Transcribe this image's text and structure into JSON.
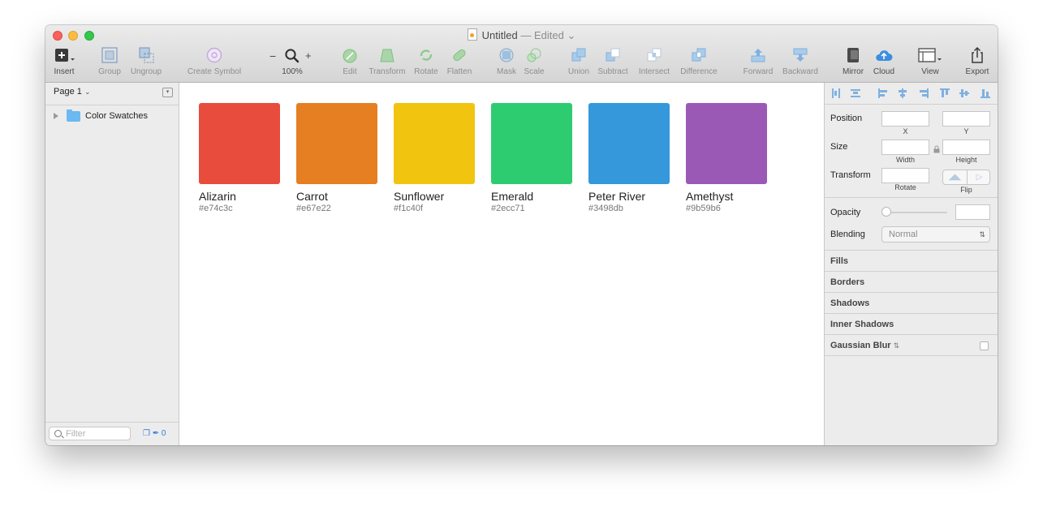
{
  "window": {
    "title": "Untitled",
    "status": "— Edited",
    "status_chevron": "⌄"
  },
  "toolbar": {
    "insert": {
      "label": "Insert",
      "icon": "plus-box-icon"
    },
    "group": {
      "label": "Group",
      "icon": "group-icon"
    },
    "ungroup": {
      "label": "Ungroup",
      "icon": "ungroup-icon"
    },
    "create_symbol": {
      "label": "Create Symbol",
      "icon": "symbol-icon"
    },
    "zoom": {
      "minus": "−",
      "plus": "+",
      "value": "100%",
      "icon": "magnifier-icon"
    },
    "edit": {
      "label": "Edit"
    },
    "transform": {
      "label": "Transform"
    },
    "rotate": {
      "label": "Rotate"
    },
    "flatten": {
      "label": "Flatten"
    },
    "mask": {
      "label": "Mask"
    },
    "scale": {
      "label": "Scale"
    },
    "union": {
      "label": "Union"
    },
    "subtract": {
      "label": "Subtract"
    },
    "intersect": {
      "label": "Intersect"
    },
    "difference": {
      "label": "Difference"
    },
    "forward": {
      "label": "Forward"
    },
    "backward": {
      "label": "Backward"
    },
    "mirror": {
      "label": "Mirror"
    },
    "cloud": {
      "label": "Cloud"
    },
    "view": {
      "label": "View"
    },
    "export": {
      "label": "Export"
    }
  },
  "sidebar": {
    "page_selector": "Page 1",
    "layers": [
      {
        "name": "Color Swatches",
        "icon": "folder-icon"
      }
    ],
    "filter_placeholder": "Filter",
    "count": "0"
  },
  "canvas": {
    "swatches": [
      {
        "name": "Alizarin",
        "hex": "#e74c3c",
        "color": "#e74c3c"
      },
      {
        "name": "Carrot",
        "hex": "#e67e22",
        "color": "#e67e22"
      },
      {
        "name": "Sunflower",
        "hex": "#f1c40f",
        "color": "#f1c40f"
      },
      {
        "name": "Emerald",
        "hex": "#2ecc71",
        "color": "#2ecc71"
      },
      {
        "name": "Peter River",
        "hex": "#3498db",
        "color": "#3498db"
      },
      {
        "name": "Amethyst",
        "hex": "#9b59b6",
        "color": "#9b59b6"
      }
    ]
  },
  "inspector": {
    "position_label": "Position",
    "x_label": "X",
    "y_label": "Y",
    "size_label": "Size",
    "width_label": "Width",
    "height_label": "Height",
    "transform_label": "Transform",
    "rotate_label": "Rotate",
    "flip_label": "Flip",
    "opacity_label": "Opacity",
    "blending_label": "Blending",
    "blending_value": "Normal",
    "sections": {
      "fills": "Fills",
      "borders": "Borders",
      "shadows": "Shadows",
      "inner_shadows": "Inner Shadows",
      "gaussian_blur": "Gaussian Blur"
    }
  }
}
